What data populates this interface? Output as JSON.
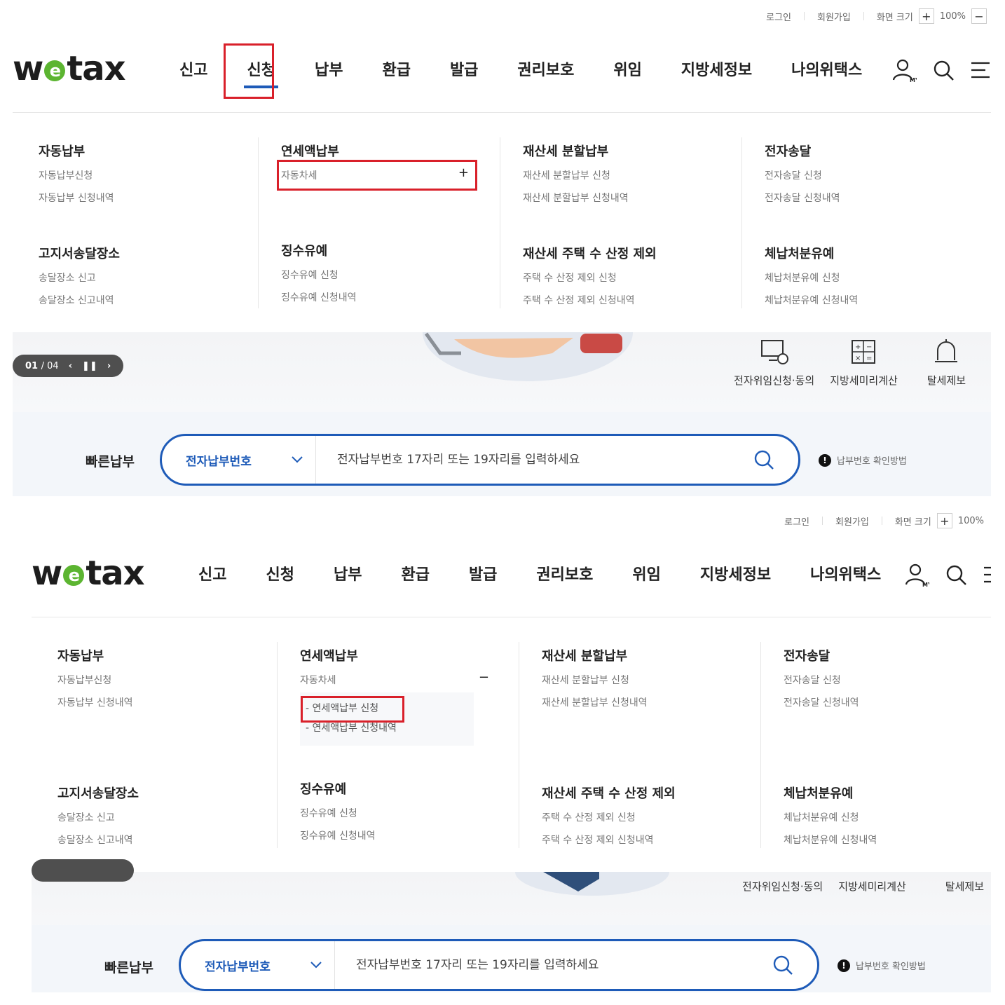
{
  "util": {
    "login": "로그인",
    "signup": "회원가입",
    "screen_size": "화면 크기",
    "zoom_in": "+",
    "zoom_value": "100%",
    "zoom_out": "−"
  },
  "logo": {
    "pre": "w",
    "e": "e",
    "post": "tax"
  },
  "gnb": [
    "신고",
    "신청",
    "납부",
    "환급",
    "발급",
    "권리보호",
    "위임",
    "지방세정보",
    "나의위택스"
  ],
  "icons": {
    "my_label": "MY"
  },
  "mega": {
    "auto_pay": {
      "title": "자동납부",
      "links": [
        "자동납부신청",
        "자동납부 신청내역"
      ]
    },
    "annual": {
      "title": "연세액납부",
      "item": "자동차세",
      "expand": "+",
      "collapse": "−",
      "subs": [
        "- 연세액납부 신청",
        "- 연세액납부 신청내역"
      ]
    },
    "split": {
      "title": "재산세 분할납부",
      "links": [
        "재산세 분할납부 신청",
        "재산세 분할납부 신청내역"
      ]
    },
    "esend": {
      "title": "전자송달",
      "links": [
        "전자송달 신청",
        "전자송달 신청내역"
      ]
    },
    "notice": {
      "title": "고지서송달장소",
      "links": [
        "송달장소 신고",
        "송달장소 신고내역"
      ]
    },
    "defer": {
      "title": "징수유예",
      "links": [
        "징수유예 신청",
        "징수유예 신청내역"
      ]
    },
    "house": {
      "title": "재산세 주택 수 산정 제외",
      "links": [
        "주택 수 산정 제외 신청",
        "주택 수 산정 제외 신청내역"
      ]
    },
    "arrears": {
      "title": "체납처분유예",
      "links": [
        "체납처분유예 신청",
        "체납처분유예 신청내역"
      ]
    }
  },
  "pager": {
    "current": "01",
    "total": "/ 04"
  },
  "quick": [
    "전자위임신청·동의",
    "지방세미리계산",
    "탈세제보"
  ],
  "fastpay": {
    "label": "빠른납부",
    "select": "전자납부번호",
    "placeholder": "전자납부번호 17자리 또는 19자리를 입력하세요",
    "help": "납부번호 확인방법",
    "help_icon": "!"
  },
  "colors": {
    "accent": "#1e5bb8",
    "highlight": "#d9202a",
    "logo_e": "#5cb531"
  }
}
